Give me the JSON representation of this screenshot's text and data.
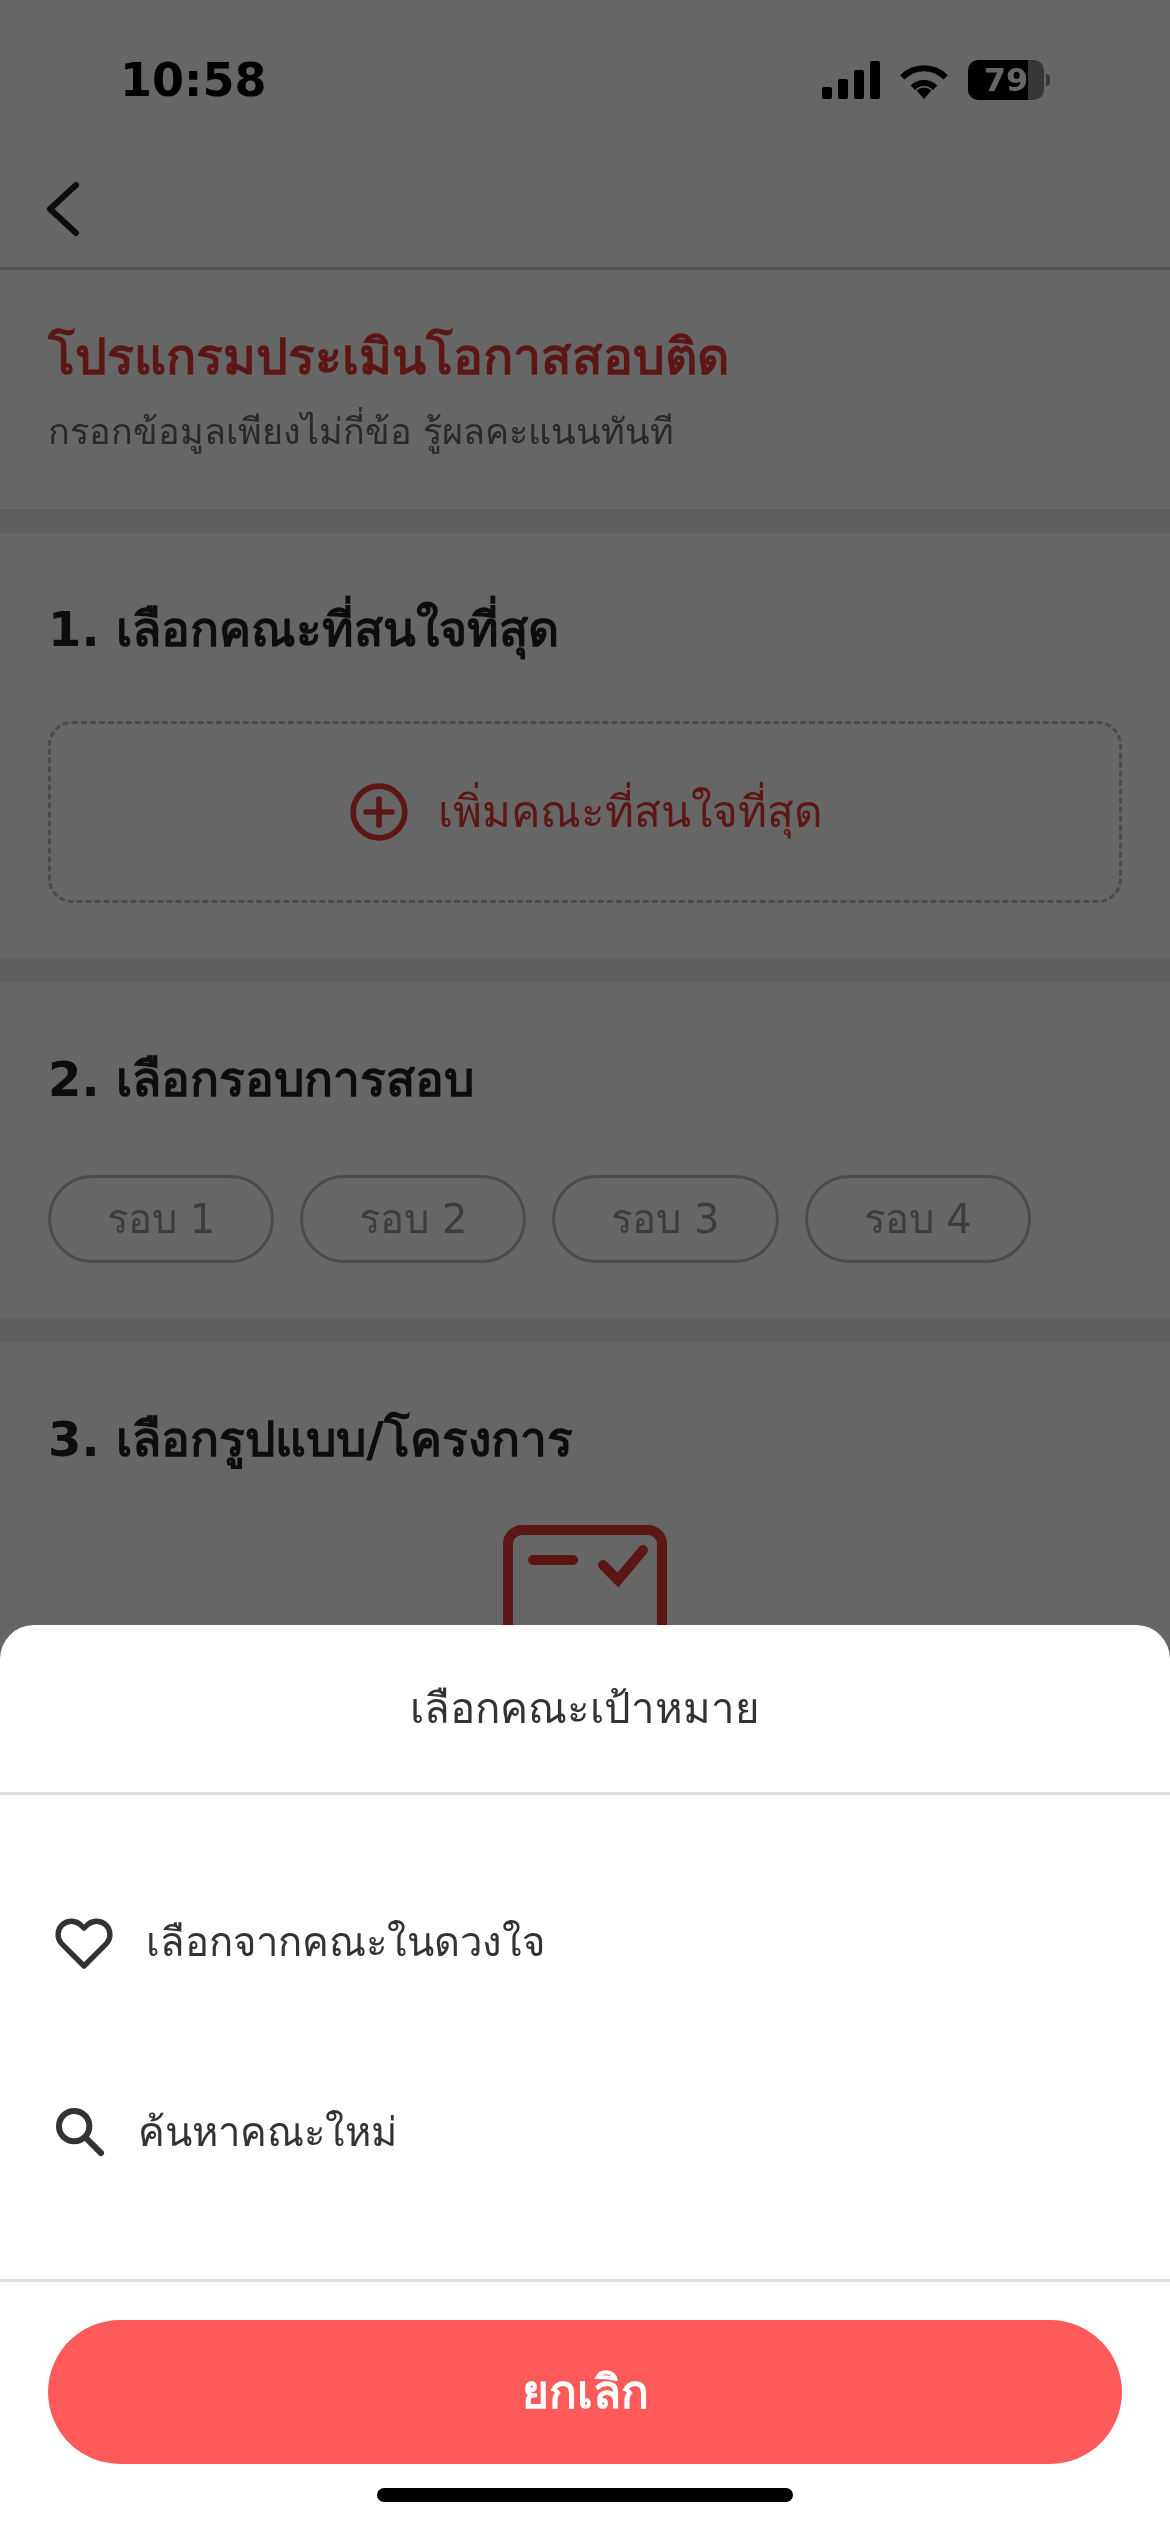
{
  "status_bar": {
    "time": "10:58",
    "battery": "79"
  },
  "header": {
    "title": "โปรแกรมประเมินโอกาสสอบติด",
    "subtitle": "กรอกข้อมูลเพียงไม่กี่ข้อ รู้ผลคะแนนทันที"
  },
  "sections": [
    {
      "kind": "add",
      "heading": "1. เลือกคณะที่สนใจที่สุด",
      "add_label": "เพิ่มคณะที่สนใจที่สุด"
    },
    {
      "kind": "chips",
      "heading": "2. เลือกรอบการสอบ",
      "chips": [
        {
          "label": "รอบ 1",
          "selected": false
        },
        {
          "label": "รอบ 2",
          "selected": false
        },
        {
          "label": "รอบ 3",
          "selected": false
        },
        {
          "label": "รอบ 4",
          "selected": false
        }
      ]
    },
    {
      "kind": "empty",
      "heading": "3. เลือกรูปแบบ/โครงการ"
    }
  ],
  "sheet": {
    "title": "เลือกคณะเป้าหมาย",
    "options": [
      {
        "kind": "heart",
        "label": "เลือกจากคณะในดวงใจ"
      },
      {
        "kind": "search",
        "label": "ค้นหาคณะใหม่"
      }
    ],
    "cancel": "ยกเลิก"
  }
}
